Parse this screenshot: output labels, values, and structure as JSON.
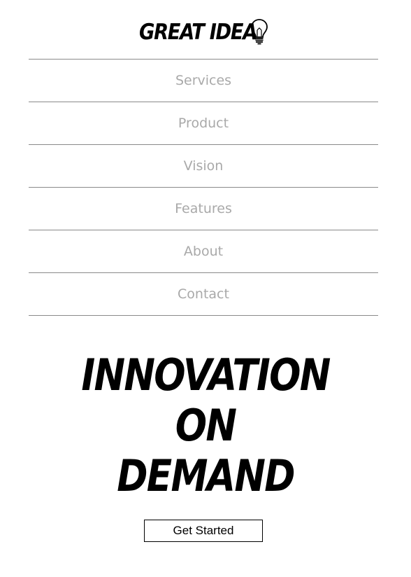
{
  "header": {
    "logo_text": "GREAT IDEA",
    "logo_icon": "lightbulb-icon"
  },
  "nav": {
    "items": [
      {
        "label": "Services"
      },
      {
        "label": "Product"
      },
      {
        "label": "Vision"
      },
      {
        "label": "Features"
      },
      {
        "label": "About"
      },
      {
        "label": "Contact"
      }
    ]
  },
  "hero": {
    "lines": [
      "INNOVATION",
      "ON",
      "DEMAND"
    ],
    "cta_label": "Get Started"
  },
  "colors": {
    "text": "#000000",
    "nav_text": "#a9a9a9",
    "divider": "#8a8a8a",
    "background": "#ffffff"
  }
}
